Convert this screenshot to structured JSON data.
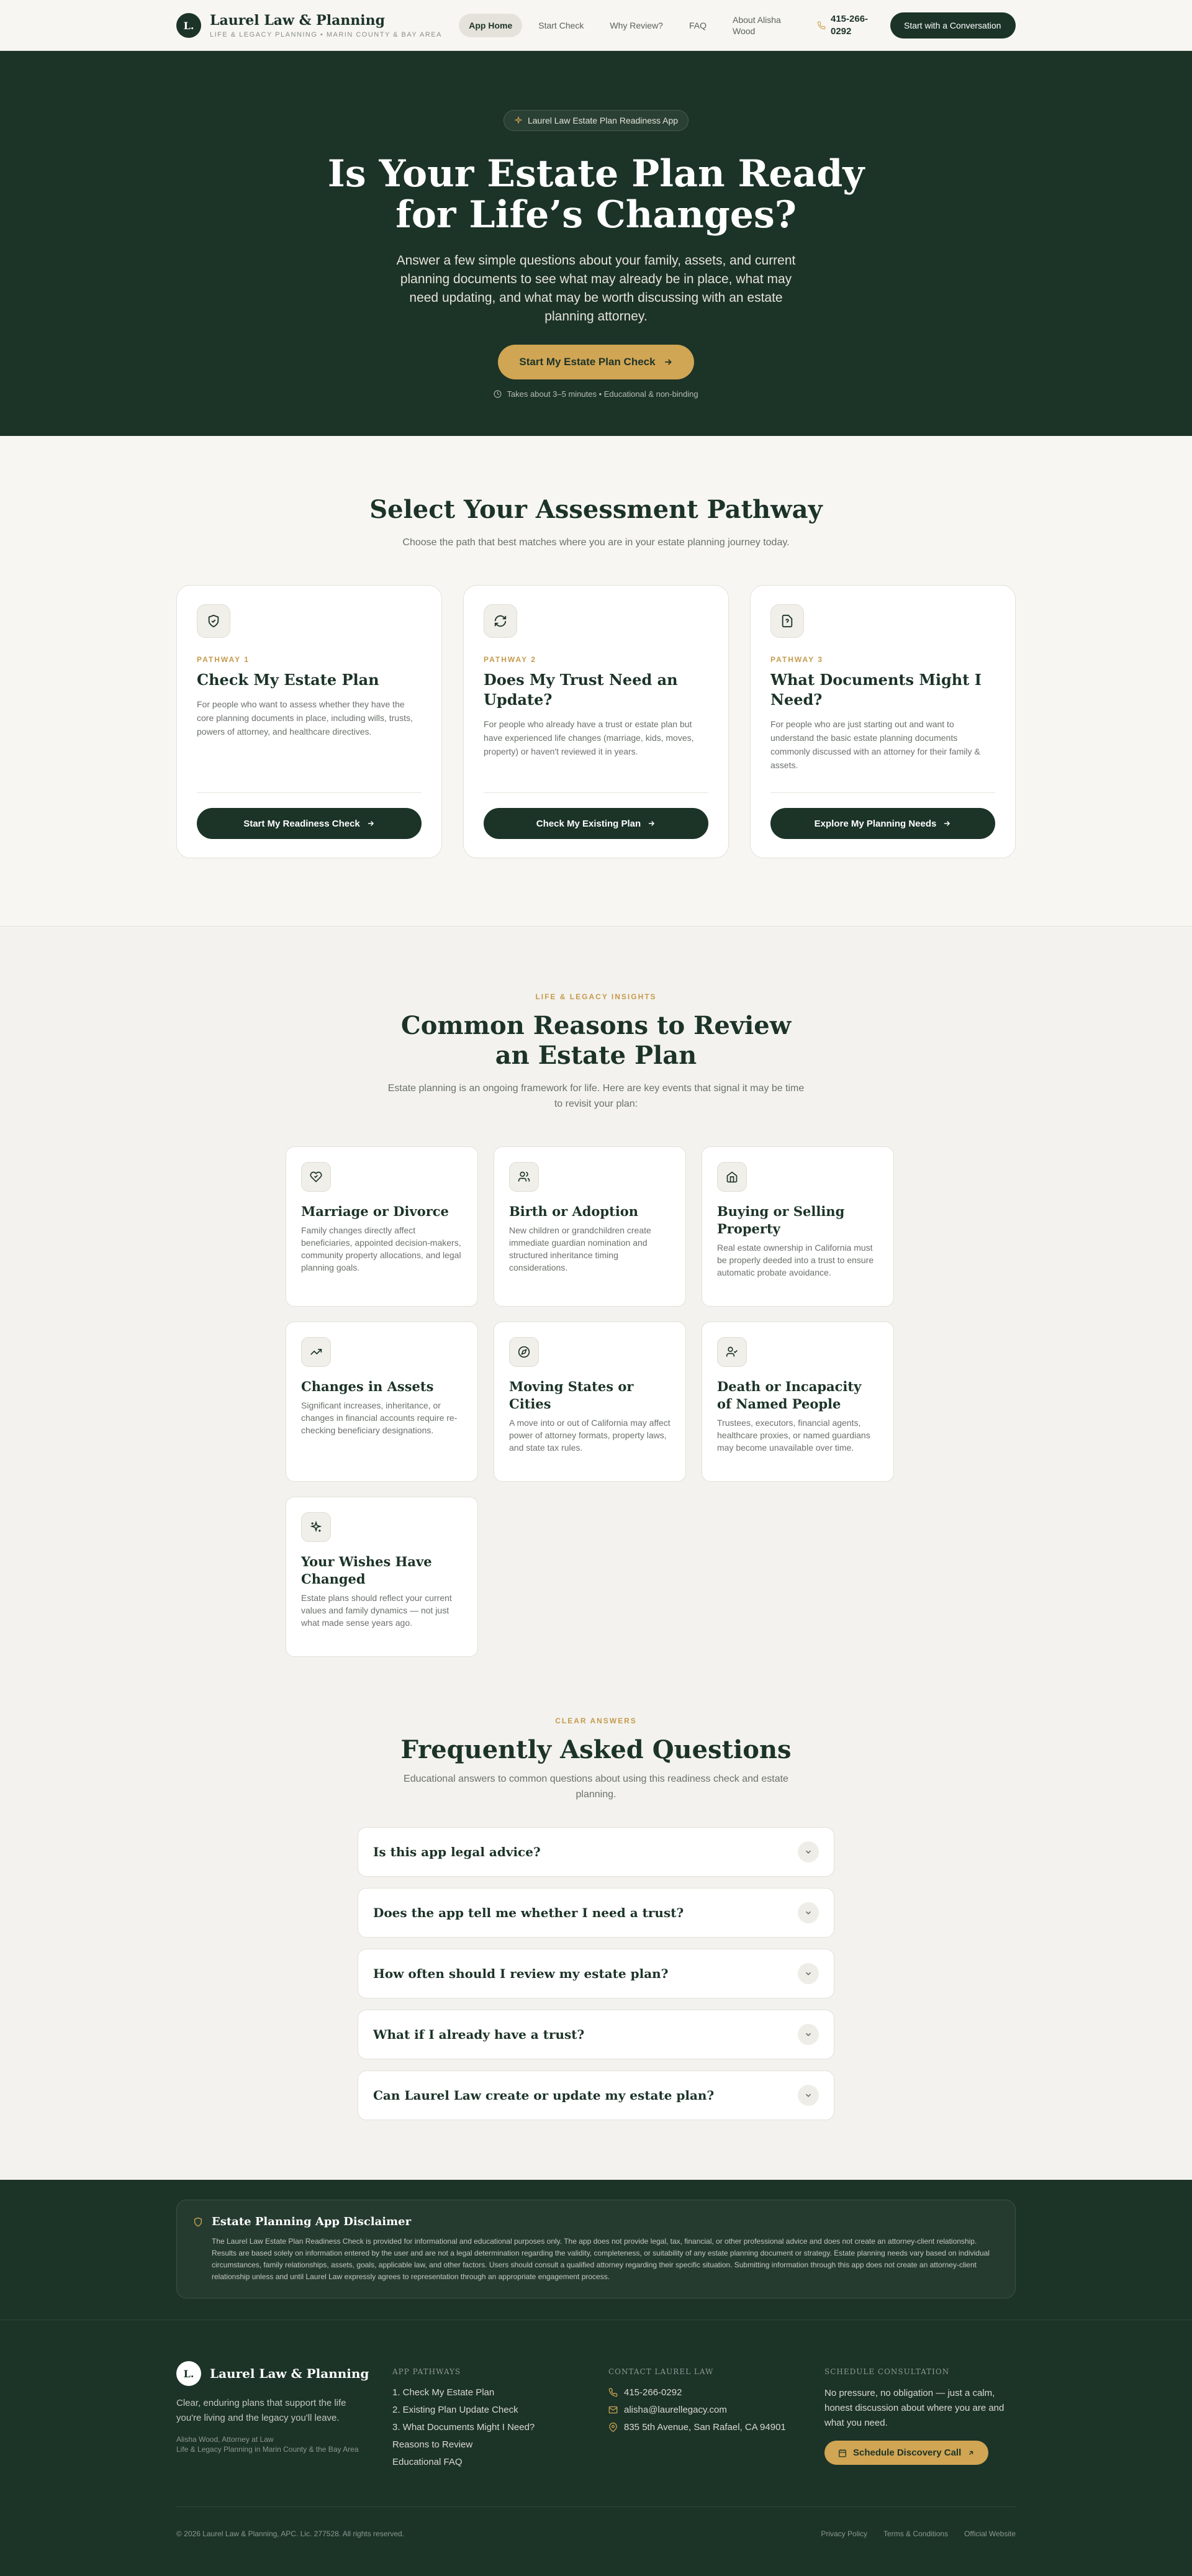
{
  "header": {
    "brand_initial": "L.",
    "brand_name": "Laurel Law & Planning",
    "brand_sub": "Life & Legacy Planning • Marin County & Bay Area",
    "nav": [
      "App Home",
      "Start Check",
      "Why Review?",
      "FAQ",
      "About Alisha Wood"
    ],
    "phone": "415-266-0292",
    "cta": "Start with a Conversation"
  },
  "hero": {
    "badge": "Laurel Law Estate Plan Readiness App",
    "title": "Is Your Estate Plan Ready for Life’s Changes?",
    "description": "Answer a few simple questions about your family, assets, and current planning documents to see what may already be in place, what may need updating, and what may be worth discussing with an estate planning attorney.",
    "button": "Start My Estate Plan Check",
    "note": "Takes about 3–5 minutes • Educational & non-binding"
  },
  "pathways": {
    "title": "Select Your Assessment Pathway",
    "subtitle": "Choose the path that best matches where you are in your estate planning journey today.",
    "cards": [
      {
        "icon": "shield-icon",
        "num": "Pathway 1",
        "title": "Check My Estate Plan",
        "desc": "For people who want to assess whether they have the core planning documents in place, including wills, trusts, powers of attorney, and healthcare directives.",
        "button": "Start My Readiness Check"
      },
      {
        "icon": "refresh-icon",
        "num": "Pathway 2",
        "title": "Does My Trust Need an Update?",
        "desc": "For people who already have a trust or estate plan but have experienced life changes (marriage, kids, moves, property) or haven't reviewed it in years.",
        "button": "Check My Existing Plan"
      },
      {
        "icon": "document-question-icon",
        "num": "Pathway 3",
        "title": "What Documents Might I Need?",
        "desc": "For people who are just starting out and want to understand the basic estate planning documents commonly discussed with an attorney for their family & assets.",
        "button": "Explore My Planning Needs"
      }
    ]
  },
  "reasons": {
    "eyebrow": "Life & Legacy Insights",
    "title": "Common Reasons to Review an Estate Plan",
    "subtitle": "Estate planning is an ongoing framework for life. Here are key events that signal it may be time to revisit your plan:",
    "items": [
      {
        "icon": "heart-icon",
        "title": "Marriage or Divorce",
        "desc": "Family changes directly affect beneficiaries, appointed decision-makers, community property allocations, and legal planning goals."
      },
      {
        "icon": "users-icon",
        "title": "Birth or Adoption",
        "desc": "New children or grandchildren create immediate guardian nomination and structured inheritance timing considerations."
      },
      {
        "icon": "home-icon",
        "title": "Buying or Selling Property",
        "desc": "Real estate ownership in California must be properly deeded into a trust to ensure automatic probate avoidance."
      },
      {
        "icon": "trending-up-icon",
        "title": "Changes in Assets",
        "desc": "Significant increases, inheritance, or changes in financial accounts require re-checking beneficiary designations."
      },
      {
        "icon": "compass-icon",
        "title": "Moving States or Cities",
        "desc": "A move into or out of California may affect power of attorney formats, property laws, and state tax rules."
      },
      {
        "icon": "user-check-icon",
        "title": "Death or Incapacity of Named People",
        "desc": "Trustees, executors, financial agents, healthcare proxies, or named guardians may become unavailable over time."
      },
      {
        "icon": "sparkles-icon",
        "title": "Your Wishes Have Changed",
        "desc": "Estate plans should reflect your current values and family dynamics — not just what made sense years ago."
      }
    ]
  },
  "faq": {
    "eyebrow": "Clear Answers",
    "title": "Frequently Asked Questions",
    "subtitle": "Educational answers to common questions about using this readiness check and estate planning.",
    "items": [
      "Is this app legal advice?",
      "Does the app tell me whether I need a trust?",
      "How often should I review my estate plan?",
      "What if I already have a trust?",
      "Can Laurel Law create or update my estate plan?"
    ]
  },
  "disclaimer": {
    "title": "Estate Planning App Disclaimer",
    "text": "The Laurel Law Estate Plan Readiness Check is provided for informational and educational purposes only. The app does not provide legal, tax, financial, or other professional advice and does not create an attorney-client relationship. Results are based solely on information entered by the user and are not a legal determination regarding the validity, completeness, or suitability of any estate planning document or strategy. Estate planning needs vary based on individual circumstances, family relationships, assets, goals, applicable law, and other factors. Users should consult a qualified attorney regarding their specific situation. Submitting information through this app does not create an attorney-client relationship unless and until Laurel Law expressly agrees to representation through an appropriate engagement process."
  },
  "footer": {
    "brand_initial": "L.",
    "brand_name": "Laurel Law & Planning",
    "tagline": "Clear, enduring plans that support the life you're living and the legacy you'll leave.",
    "meta_line1": "Alisha Wood, Attorney at Law",
    "meta_line2": "Life & Legacy Planning in Marin County & the Bay Area",
    "pathways_head": "App Pathways",
    "pathway_links": [
      "1. Check My Estate Plan",
      "2. Existing Plan Update Check",
      "3. What Documents Might I Need?",
      "Reasons to Review",
      "Educational FAQ"
    ],
    "contact_head": "Contact Laurel Law",
    "phone": "415-266-0292",
    "email": "alisha@laurellegacy.com",
    "address": "835 5th Avenue, San Rafael, CA 94901",
    "schedule_head": "Schedule Consultation",
    "schedule_text": "No pressure, no obligation — just a calm, honest discussion about where you are and what you need.",
    "schedule_button": "Schedule Discovery Call",
    "copyright": "© 2026 Laurel Law & Planning, APC. Lic. 277528. All rights reserved.",
    "legal": [
      "Privacy Policy",
      "Terms & Conditions",
      "Official Website"
    ]
  },
  "colors": {
    "primary": "#1c3328",
    "accent": "#d0a553",
    "background": "#f3f2ee"
  }
}
